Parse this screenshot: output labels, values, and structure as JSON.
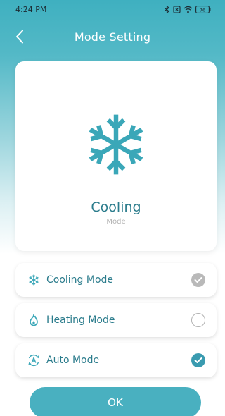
{
  "status_bar": {
    "time": "4:24 PM",
    "battery": "76"
  },
  "nav": {
    "title": "Mode Setting"
  },
  "current_mode": {
    "title": "Cooling",
    "subtitle": "Mode",
    "icon": "snowflake-icon"
  },
  "options": [
    {
      "label": "Cooling Mode",
      "icon": "snowflake-icon",
      "state": "checked-disabled"
    },
    {
      "label": "Heating Mode",
      "icon": "flame-icon",
      "state": "unchecked"
    },
    {
      "label": "Auto Mode",
      "icon": "auto-mode-icon",
      "state": "checked"
    }
  ],
  "ok_label": "OK",
  "colors": {
    "accent": "#49b0c0",
    "text_accent": "#2b7c8c",
    "header_gradient_top": "#3fb0c0"
  }
}
